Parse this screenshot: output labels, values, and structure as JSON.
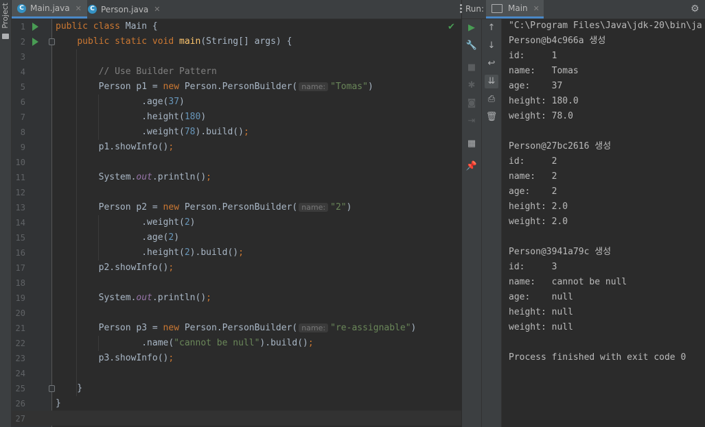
{
  "sidebar": {
    "project_label": "Project"
  },
  "tabs": [
    {
      "label": "Main.java",
      "active": true
    },
    {
      "label": "Person.java",
      "active": false
    }
  ],
  "editor": {
    "lines": [
      {
        "n": "1",
        "run": true,
        "fold": false,
        "tokens": [
          [
            "kw",
            "public class "
          ],
          [
            "",
            "Main {"
          ]
        ]
      },
      {
        "n": "2",
        "run": true,
        "fold": true,
        "tokens": [
          [
            "",
            "    "
          ],
          [
            "kw",
            "public static void "
          ],
          [
            "fn",
            "main"
          ],
          [
            "",
            "(String[] args) {"
          ]
        ]
      },
      {
        "n": "3",
        "tokens": []
      },
      {
        "n": "4",
        "tokens": [
          [
            "",
            "        "
          ],
          [
            "cm",
            "// Use Builder Pattern"
          ]
        ]
      },
      {
        "n": "5",
        "tokens": [
          [
            "",
            "        Person p1 = "
          ],
          [
            "kw",
            "new "
          ],
          [
            "",
            "Person.PersonBuilder("
          ],
          [
            "hint",
            "name:"
          ],
          [
            "str",
            "\"Tomas\""
          ],
          [
            "",
            ")"
          ]
        ]
      },
      {
        "n": "6",
        "tokens": [
          [
            "",
            "                .age("
          ],
          [
            "num",
            "37"
          ],
          [
            "",
            ")"
          ]
        ]
      },
      {
        "n": "7",
        "tokens": [
          [
            "",
            "                .height("
          ],
          [
            "num",
            "180"
          ],
          [
            "",
            ")"
          ]
        ]
      },
      {
        "n": "8",
        "tokens": [
          [
            "",
            "                .weight("
          ],
          [
            "num",
            "78"
          ],
          [
            "",
            ").build()"
          ],
          [
            "kw",
            ";"
          ]
        ]
      },
      {
        "n": "9",
        "tokens": [
          [
            "",
            "        p1.showInfo()"
          ],
          [
            "kw",
            ";"
          ]
        ]
      },
      {
        "n": "10",
        "tokens": []
      },
      {
        "n": "11",
        "tokens": [
          [
            "",
            "        System."
          ],
          [
            "it",
            "out"
          ],
          [
            "",
            ".println()"
          ],
          [
            "kw",
            ";"
          ]
        ]
      },
      {
        "n": "12",
        "tokens": []
      },
      {
        "n": "13",
        "tokens": [
          [
            "",
            "        Person p2 = "
          ],
          [
            "kw",
            "new "
          ],
          [
            "",
            "Person.PersonBuilder("
          ],
          [
            "hint",
            "name:"
          ],
          [
            "str",
            "\"2\""
          ],
          [
            "",
            ")"
          ]
        ]
      },
      {
        "n": "14",
        "tokens": [
          [
            "",
            "                .weight("
          ],
          [
            "num",
            "2"
          ],
          [
            "",
            ")"
          ]
        ]
      },
      {
        "n": "15",
        "tokens": [
          [
            "",
            "                .age("
          ],
          [
            "num",
            "2"
          ],
          [
            "",
            ")"
          ]
        ]
      },
      {
        "n": "16",
        "tokens": [
          [
            "",
            "                .height("
          ],
          [
            "num",
            "2"
          ],
          [
            "",
            ").build()"
          ],
          [
            "kw",
            ";"
          ]
        ]
      },
      {
        "n": "17",
        "tokens": [
          [
            "",
            "        p2.showInfo()"
          ],
          [
            "kw",
            ";"
          ]
        ]
      },
      {
        "n": "18",
        "tokens": []
      },
      {
        "n": "19",
        "tokens": [
          [
            "",
            "        System."
          ],
          [
            "it",
            "out"
          ],
          [
            "",
            ".println()"
          ],
          [
            "kw",
            ";"
          ]
        ]
      },
      {
        "n": "20",
        "tokens": []
      },
      {
        "n": "21",
        "tokens": [
          [
            "",
            "        Person p3 = "
          ],
          [
            "kw",
            "new "
          ],
          [
            "",
            "Person.PersonBuilder("
          ],
          [
            "hint",
            "name:"
          ],
          [
            "str",
            "\"re-assignable\""
          ],
          [
            "",
            ")"
          ]
        ]
      },
      {
        "n": "22",
        "tokens": [
          [
            "",
            "                .name("
          ],
          [
            "str",
            "\"cannot be null\""
          ],
          [
            "",
            ").build()"
          ],
          [
            "kw",
            ";"
          ]
        ]
      },
      {
        "n": "23",
        "tokens": [
          [
            "",
            "        p3.showInfo()"
          ],
          [
            "kw",
            ";"
          ]
        ]
      },
      {
        "n": "24",
        "tokens": []
      },
      {
        "n": "25",
        "fold": true,
        "tokens": [
          [
            "",
            "    }"
          ]
        ]
      },
      {
        "n": "26",
        "tokens": [
          [
            "",
            "}"
          ]
        ]
      },
      {
        "n": "27",
        "tokens": []
      }
    ]
  },
  "run": {
    "label": "Run:",
    "tab_label": "Main",
    "console": [
      "\"C:\\Program Files\\Java\\jdk-20\\bin\\ja",
      "Person@b4c966a 생성",
      "id:     1",
      "name:   Tomas",
      "age:    37",
      "height: 180.0",
      "weight: 78.0",
      "",
      "Person@27bc2616 생성",
      "id:     2",
      "name:   2",
      "age:    2",
      "height: 2.0",
      "weight: 2.0",
      "",
      "Person@3941a79c 생성",
      "id:     3",
      "name:   cannot be null",
      "age:    null",
      "height: null",
      "weight: null",
      "",
      "Process finished with exit code 0"
    ]
  },
  "icons": {
    "toolbar_left": [
      "run-icon",
      "wrench-icon",
      "stop-icon",
      "debug-icon",
      "camera-icon",
      "exit-icon",
      "layout-icon",
      "pin-icon"
    ],
    "toolbar_right": [
      "up-arrow-icon",
      "down-arrow-icon",
      "soft-wrap-icon",
      "scroll-to-end-icon",
      "print-icon",
      "trash-icon"
    ]
  }
}
